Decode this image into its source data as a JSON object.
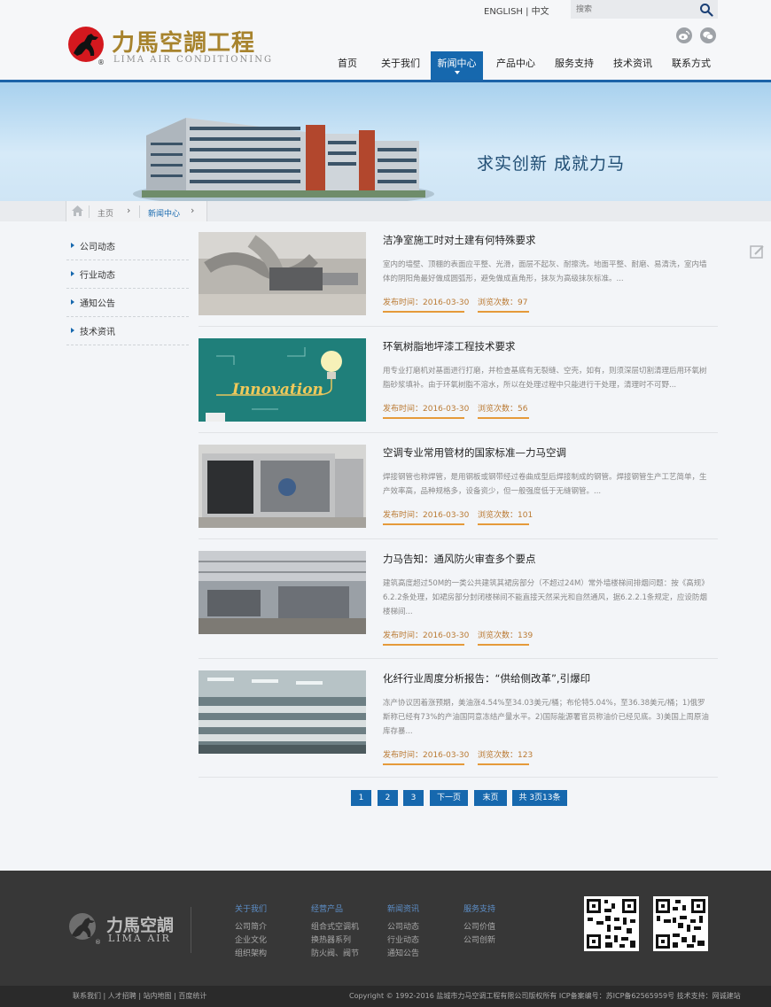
{
  "header": {
    "logo_cn": "力馬空調工程",
    "logo_en": "LIMA AIR CONDITIONING",
    "logo_reg": "®",
    "lang_en": "ENGLISH",
    "lang_sep": " | ",
    "lang_cn": "中文",
    "search_placeholder": "搜索"
  },
  "nav": {
    "items": [
      {
        "label": "首页"
      },
      {
        "label": "关于我们"
      },
      {
        "label": "新闻中心"
      },
      {
        "label": "产品中心"
      },
      {
        "label": "服务支持"
      },
      {
        "label": "技术资讯"
      },
      {
        "label": "联系方式"
      }
    ],
    "active_index": 2
  },
  "banner": {
    "slogan": "求实创新  成就力马"
  },
  "breadcrumb": {
    "home": "主页",
    "current": "新闻中心"
  },
  "sidebar": {
    "items": [
      {
        "label": "公司动态"
      },
      {
        "label": "行业动态"
      },
      {
        "label": "通知公告"
      },
      {
        "label": "技术资讯"
      }
    ]
  },
  "articles": [
    {
      "title": "洁净室施工时对土建有何特殊要求",
      "desc": "室内的墙壁、顶棚的表面应平整、光滑，面层不起灰、耐擦洗。地面平整、耐磨、易清洗，室内墙体的阴阳角最好做成圆弧形，避免做成直角形，抹灰为高级抹灰标准。...",
      "date": "发布时间：2016-03-30",
      "views": "浏览次数：97"
    },
    {
      "title": "环氧树脂地坪漆工程技术要求",
      "desc": "用专业打磨机对基面进行打磨，并检查基底有无裂缝、空壳，如有，则须深层切割清理后用环氧树脂砂浆填补。由于环氧树脂不溶水，所以在处理过程中只能进行干处理，清理时不可野...",
      "date": "发布时间：2016-03-30",
      "views": "浏览次数：56",
      "thumb_text": "Innovation"
    },
    {
      "title": "空调专业常用管材的国家标准—力马空调",
      "desc": "焊接钢管也称焊管，是用钢板或钢带经过卷曲成型后焊接制成的钢管。焊接钢管生产工艺简单，生产效率高，品种规格多，设备资少，但一般强度低于无缝钢管。...",
      "date": "发布时间：2016-03-30",
      "views": "浏览次数：101"
    },
    {
      "title": "力马告知：通风防火审查多个要点",
      "desc": "建筑高度超过50M的一类公共建筑其裙房部分（不超过24M）常外墙楼梯间排烟问题：按《高规》6.2.2条处理，如裙房部分封闭楼梯间不能直接天然采光和自然通风，据6.2.2.1条规定，应设防烟楼梯间...",
      "date": "发布时间：2016-03-30",
      "views": "浏览次数：139"
    },
    {
      "title": "化纤行业周度分析报告：“供给侧改革”,引爆印",
      "desc": "冻产协议因着涨预期，美油涨4.54%至34.03美元/桶；布伦特5.04%，至36.38美元/桶；1)俄罗斯称已经有73%的产油国同意冻结产量水平。2)国际能源署官员称油价已经见底。3)美国上周原油库存暴...",
      "date": "发布时间：2016-03-30",
      "views": "浏览次数：123"
    }
  ],
  "pagination": {
    "pages": [
      "1",
      "2",
      "3"
    ],
    "next": "下一页",
    "last": "末页",
    "summary": "共 3页13条"
  },
  "footer": {
    "logo_cn": "力馬空調",
    "logo_en": "LIMA AIR",
    "logo_reg": "®",
    "columns": [
      {
        "heading": "关于我们",
        "items": [
          "公司简介",
          "企业文化",
          "组织架构"
        ]
      },
      {
        "heading": "经营产品",
        "items": [
          "组合式空调机",
          "换热器系列",
          "防火阀、阀节"
        ]
      },
      {
        "heading": "新闻资讯",
        "items": [
          "公司动态",
          "行业动态",
          "通知公告"
        ]
      },
      {
        "heading": "服务支持",
        "items": [
          "公司价值",
          "公司创新"
        ]
      }
    ],
    "bottom_links": [
      "联系我们",
      "人才招聘",
      "站内地图",
      "百度统计"
    ],
    "bottom_sep": " | ",
    "copyright": "Copyright © 1992-2016 盐城市力马空调工程有限公司版权所有 ICP备案编号：苏ICP备62565959号 技术支持：网诚建站"
  },
  "colors": {
    "brand_blue": "#1668ae",
    "logo_gold": "#a7832d",
    "logo_red": "#d4181e",
    "meta_orange": "#e59a3a",
    "footer_bg": "#373737"
  },
  "icons": [
    "search-icon",
    "weibo-icon",
    "wechat-icon",
    "home-icon",
    "edit-icon",
    "qr-code-icon"
  ]
}
